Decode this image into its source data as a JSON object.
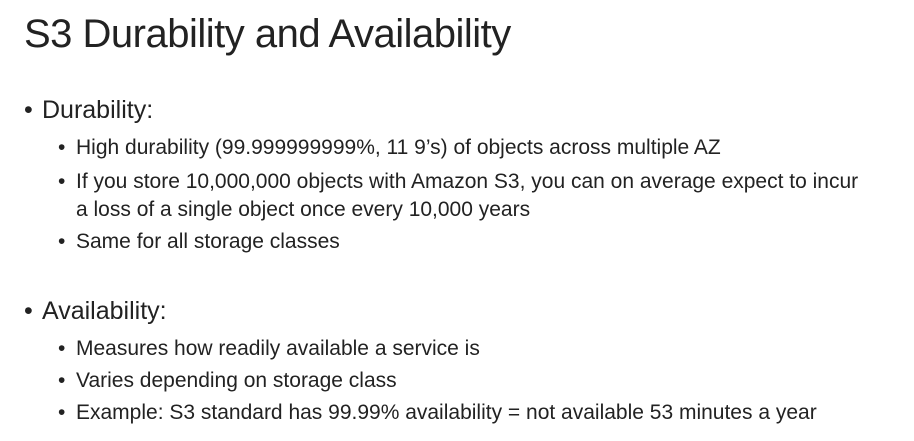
{
  "slide": {
    "title": "S3 Durability and Availability",
    "sections": [
      {
        "heading": "Durability:",
        "points": [
          "High durability (99.999999999%, 11 9’s) of objects across multiple AZ",
          "If you store 10,000,000 objects with Amazon S3, you can on average expect to incur a loss of a single object once every 10,000 years",
          "Same for all storage classes"
        ]
      },
      {
        "heading": "Availability:",
        "points": [
          "Measures how readily available a service is",
          "Varies depending on storage class",
          "Example: S3 standard has 99.99% availability = not available 53 minutes a year"
        ]
      }
    ]
  },
  "icons": {
    "bullet": "bullet-dot"
  }
}
